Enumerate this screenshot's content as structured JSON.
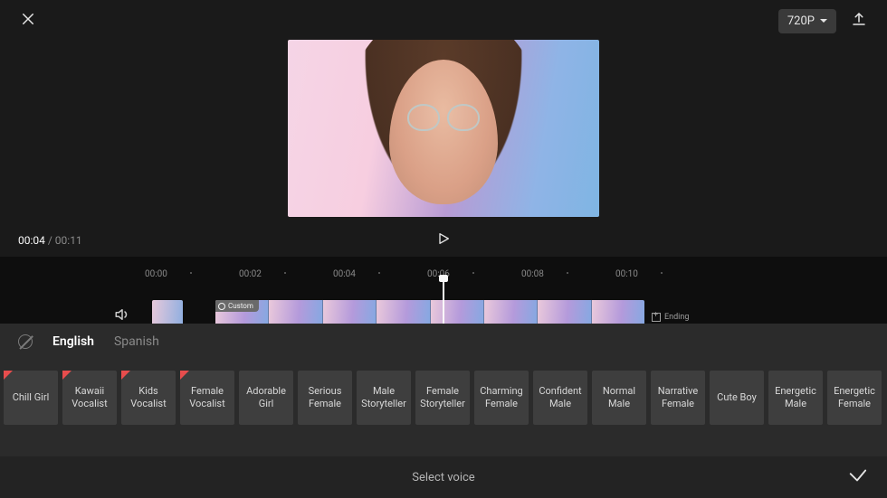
{
  "header": {
    "quality_label": "720P"
  },
  "playback": {
    "current_time": "00:04",
    "separator": " / ",
    "total_time": "00:11"
  },
  "ruler": {
    "ticks": [
      "00:00",
      "00:02",
      "00:04",
      "00:06",
      "00:08",
      "00:10"
    ]
  },
  "timeline": {
    "custom_badge": "Custom",
    "ending_label": "Ending"
  },
  "voice_panel": {
    "languages": {
      "active": "English",
      "inactive": "Spanish"
    },
    "voices": [
      {
        "label": "Chill Girl",
        "new": true
      },
      {
        "label": "Kawaii Vocalist",
        "new": true
      },
      {
        "label": "Kids Vocalist",
        "new": true
      },
      {
        "label": "Female Vocalist",
        "new": true
      },
      {
        "label": "Adorable Girl",
        "new": false
      },
      {
        "label": "Serious Female",
        "new": false
      },
      {
        "label": "Male Storyteller",
        "new": false
      },
      {
        "label": "Female Storyteller",
        "new": false
      },
      {
        "label": "Charming Female",
        "new": false
      },
      {
        "label": "Confident Male",
        "new": false
      },
      {
        "label": "Normal Male",
        "new": false
      },
      {
        "label": "Narrative Female",
        "new": false
      },
      {
        "label": "Cute Boy",
        "new": false
      },
      {
        "label": "Energetic Male",
        "new": false
      },
      {
        "label": "Energetic Female",
        "new": false
      }
    ],
    "bottom_label": "Select voice"
  }
}
